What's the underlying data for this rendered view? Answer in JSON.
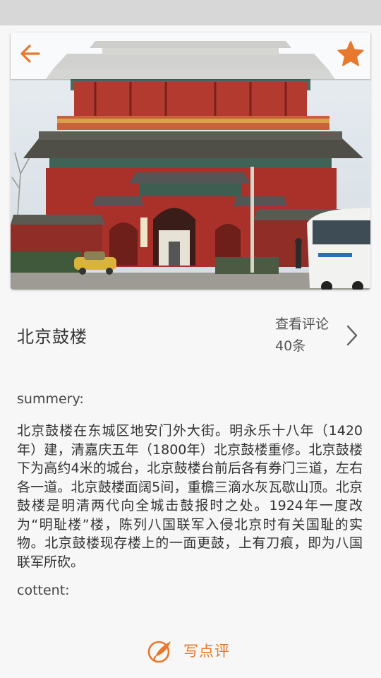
{
  "header": {
    "back_icon": "back-arrow-icon",
    "favorite_icon": "star-icon",
    "accent_color": "#e8782c"
  },
  "hero": {
    "image": "drum-tower-photo"
  },
  "place": {
    "title": "北京鼓楼",
    "review_link_label": "查看评论",
    "review_count": "40条"
  },
  "content": {
    "summary_label": "summery:",
    "summary_text": "北京鼓楼在东城区地安门外大街。明永乐十八年（1420年）建，清嘉庆五年（1800年）北京鼓楼重修。北京鼓楼下为高约4米的城台，北京鼓楼台前后各有券门三道，左右各一道。北京鼓楼面阔5间，重檐三滴水灰瓦歇山顶。北京鼓楼是明清两代向全城击鼓报时之处。1924年一度改为“明耻楼”楼，陈列八国联军入侵北京时有关国耻的实物。北京鼓楼现存楼上的一面更鼓，上有刀痕，即为八国联军所砍。",
    "content_label": "cottent:"
  },
  "footer": {
    "write_review_label": "写点评",
    "write_review_icon": "pen-icon"
  }
}
